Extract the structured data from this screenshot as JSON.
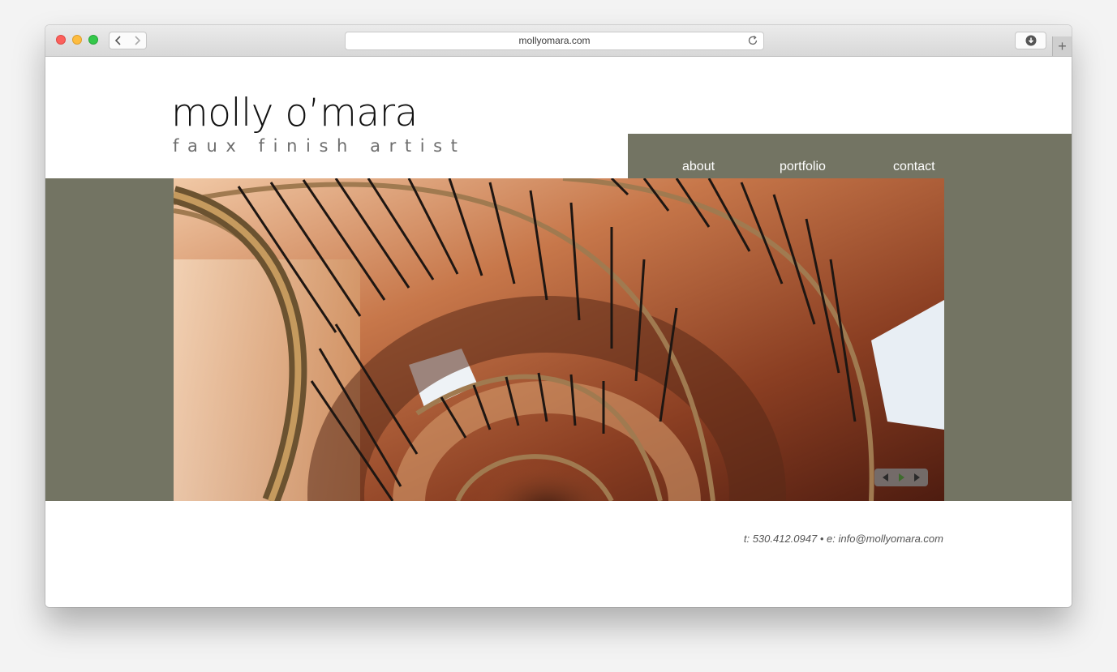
{
  "browser": {
    "url": "mollyomara.com"
  },
  "site": {
    "logo_name": "molly o’mara",
    "logo_tagline": "faux finish artist",
    "nav": {
      "about": "about",
      "portfolio": "portfolio",
      "contact": "contact"
    },
    "hero": {
      "image_icon": "spiral-staircase-photo"
    },
    "footer": {
      "phone": "t: 530.412.0947",
      "separator": "•",
      "email": "e: info@mollyomara.com"
    }
  },
  "colors": {
    "band": "#737463",
    "play_arrow": "#3f6b2e"
  }
}
